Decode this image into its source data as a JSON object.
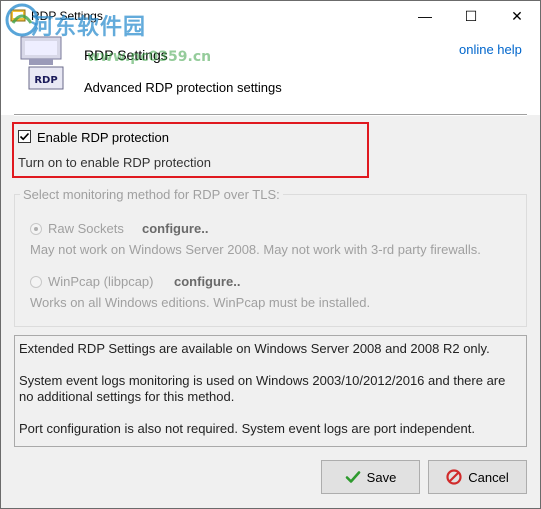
{
  "window": {
    "title": "RDP Settings",
    "minimize_glyph": "—",
    "maximize_glyph": "☐",
    "close_glyph": "✕"
  },
  "watermark": {
    "text": "河东软件园",
    "url": "www.pc0359.cn"
  },
  "header": {
    "icon_text": "RDP",
    "title": "RDP Settings",
    "subtitle": "Advanced RDP protection settings",
    "help_link": "online help"
  },
  "enable": {
    "checked": true,
    "label": "Enable RDP protection",
    "description": "Turn on to enable RDP protection"
  },
  "monitoring": {
    "legend": "Select monitoring method for RDP over TLS:",
    "options": [
      {
        "label": "Raw Sockets",
        "selected": true,
        "configure": "configure..",
        "description": "May not work on Windows Server 2008. May not work with 3-rd party firewalls."
      },
      {
        "label": "WinPcap (libpcap)",
        "selected": false,
        "configure": "configure..",
        "description": "Works on all Windows editions. WinPcap must be installed."
      }
    ]
  },
  "info": {
    "lines": [
      "Extended RDP Settings are available on Windows Server 2008 and 2008 R2 only.",
      "System event logs monitoring is used on Windows 2003/10/2012/2016 and there are no additional settings for this method.",
      "Port configuration is also not required. System event logs are port independent."
    ]
  },
  "buttons": {
    "save": "Save",
    "cancel": "Cancel"
  },
  "colors": {
    "highlight_border": "#e0191f",
    "link": "#0066cc",
    "disabled_text": "#a0a0a0",
    "save_icon": "#2e9a2e",
    "cancel_icon": "#d12b2b"
  },
  "icons": {
    "title": "app-window-icon",
    "header": "rdp-monitor-icon",
    "save": "checkmark-icon",
    "cancel": "no-entry-icon"
  }
}
